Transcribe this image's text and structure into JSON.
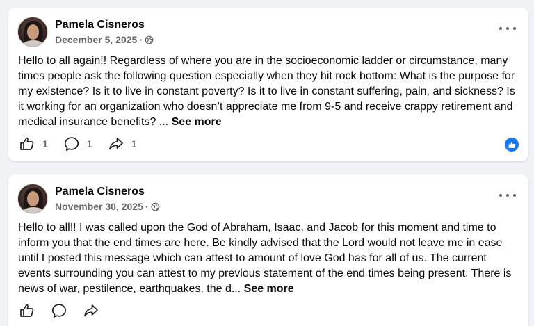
{
  "posts": [
    {
      "author": "Pamela Cisneros",
      "date": "December 5, 2025",
      "separator": "·",
      "text": "Hello to all again!! Regardless of where you are in the socioeconomic ladder or circumstance, many times people ask the following question especially when they hit rock bottom: What is the purpose for my existence? Is it to live in constant poverty? Is it to live in constant suffering, pain, and sickness? Is it working for an organization who doesn’t appreciate me from 9-5 and receive crappy retirement and medical insurance benefits? ... ",
      "see_more": "See more",
      "like_count": "1",
      "comment_count": "1",
      "share_count": "1",
      "reaction_icon": "like-reaction-icon"
    },
    {
      "author": "Pamela Cisneros",
      "date": "November 30, 2025",
      "separator": "·",
      "text": "Hello to all!! I was called upon the God of Abraham, Isaac, and Jacob for this moment and time to inform you that the end times are here. Be kindly advised that the Lord would not leave me in ease until I posted this message which can attest to amount of love God has for all of us. The current events surrounding you can attest to my previous statement of the end times being present. There is news of war, pestilence, earthquakes, the d... ",
      "see_more": "See more"
    }
  ],
  "colors": {
    "background": "#f0f2f5",
    "card": "#ffffff",
    "secondary_text": "#65676b",
    "accent": "#1877f2"
  },
  "icons": {
    "privacy": "globe-icon",
    "more": "more-options-icon",
    "like": "thumbs-up-icon",
    "comment": "comment-bubble-icon",
    "share": "share-arrow-icon"
  }
}
